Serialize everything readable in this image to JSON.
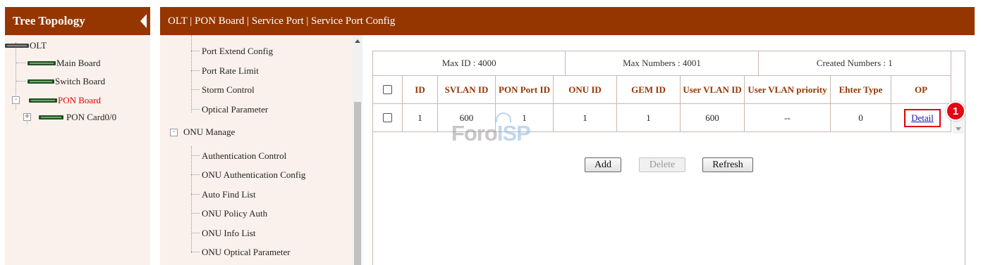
{
  "tree": {
    "title": "Tree Topology",
    "nodes": {
      "olt": "OLT",
      "main_board": "Main Board",
      "switch_board": "Switch Board",
      "pon_board": "PON Board",
      "pon_card": "PON Card0/0"
    }
  },
  "breadcrumb": "OLT | PON Board | Service Port | Service Port Config",
  "menu": {
    "items_top": [
      "Port Extend Config",
      "Port Rate Limit",
      "Storm Control",
      "Optical Parameter"
    ],
    "group": "ONU Manage",
    "items_onu": [
      "Authentication Control",
      "ONU Authentication Config",
      "Auto Find List",
      "ONU Policy Auth",
      "ONU Info List",
      "ONU Optical Parameter"
    ]
  },
  "stats": {
    "max_id": "Max ID : 4000",
    "max_numbers": "Max Numbers : 4001",
    "created": "Created Numbers : 1"
  },
  "table": {
    "columns": [
      "ID",
      "SVLAN ID",
      "PON Port ID",
      "ONU ID",
      "GEM ID",
      "User VLAN ID",
      "User VLAN priority",
      "Ehter Type",
      "OP"
    ],
    "rows": [
      {
        "id": "1",
        "svlan": "600",
        "pon_port": "1",
        "onu": "1",
        "gem": "1",
        "user_vlan": "600",
        "priority": "--",
        "ether_type": "0",
        "op": "Detail"
      }
    ]
  },
  "buttons": {
    "add": "Add",
    "delete": "Delete",
    "refresh": "Refresh"
  },
  "annotation": "1",
  "watermark": {
    "part1": "Foro",
    "part2": "ISP"
  },
  "colors": {
    "header": "#953600",
    "panel": "#fbf1ec",
    "highlight": "#e30613"
  }
}
